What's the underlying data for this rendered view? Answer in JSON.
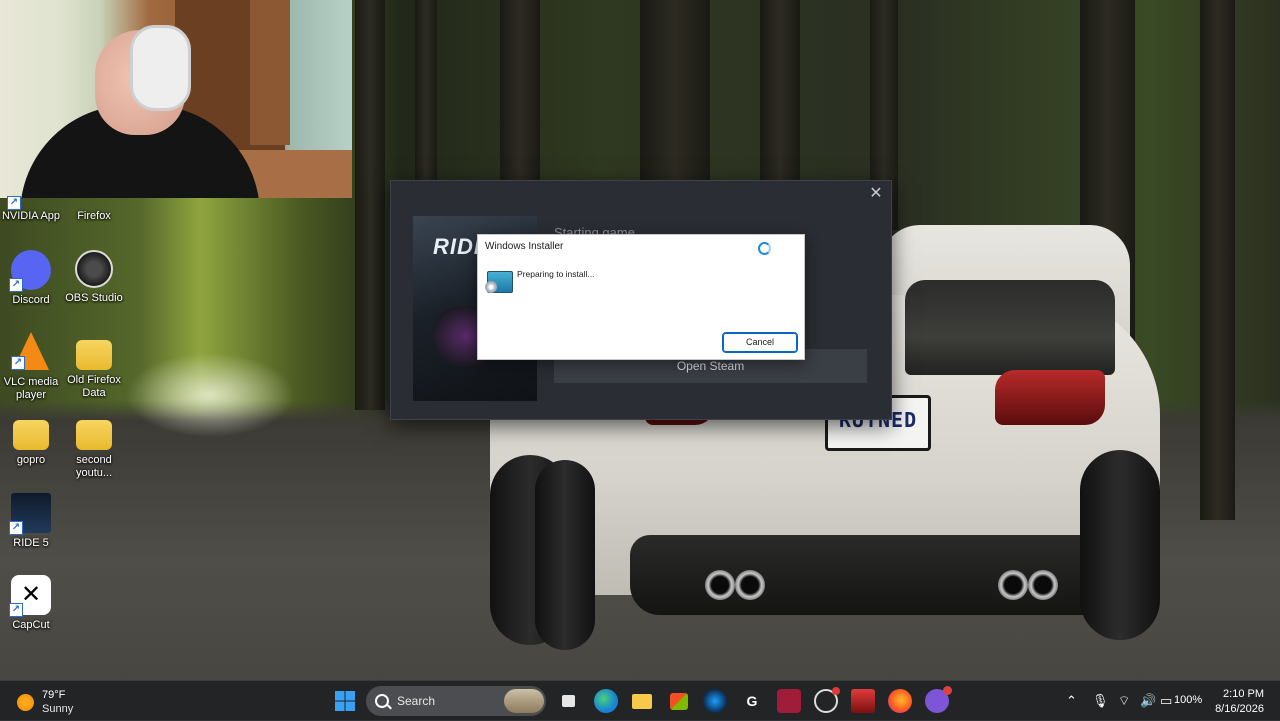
{
  "desktop": {
    "icons": [
      {
        "label": "NVIDIA App"
      },
      {
        "label": "Firefox"
      },
      {
        "label": "Discord"
      },
      {
        "label": "OBS Studio"
      },
      {
        "label": "VLC media player"
      },
      {
        "label": "Old Firefox Data"
      },
      {
        "label": "gopro"
      },
      {
        "label": "second youtu..."
      },
      {
        "label": "RIDE 5"
      },
      {
        "label": "CapCut"
      }
    ]
  },
  "wallpaper": {
    "plate_text": "RUTNED"
  },
  "steam_launch": {
    "status_text": "Starting game...",
    "art_logo": "RIDE",
    "open_button": "Open Steam",
    "close_glyph": "✕"
  },
  "installer_dialog": {
    "title": "Windows Installer",
    "message": "Preparing to install...",
    "cancel_label": "Cancel"
  },
  "taskbar": {
    "weather": {
      "temp": "79°F",
      "condition": "Sunny"
    },
    "search_label": "Search",
    "apps": [
      "start",
      "search",
      "task-view",
      "edge",
      "file-explorer",
      "microsoft-store",
      "steam",
      "logitech-g-hub",
      "ride5-launcher",
      "obs-studio",
      "forza",
      "firefox",
      "discord"
    ],
    "tray": {
      "battery": "100%"
    },
    "clock": {
      "time": "2:10 PM",
      "date": "8/16/2026"
    }
  },
  "colors": {
    "accent_blue": "#1e88e5",
    "steam_window": "#2a2d33",
    "taskbar": "#202224"
  }
}
